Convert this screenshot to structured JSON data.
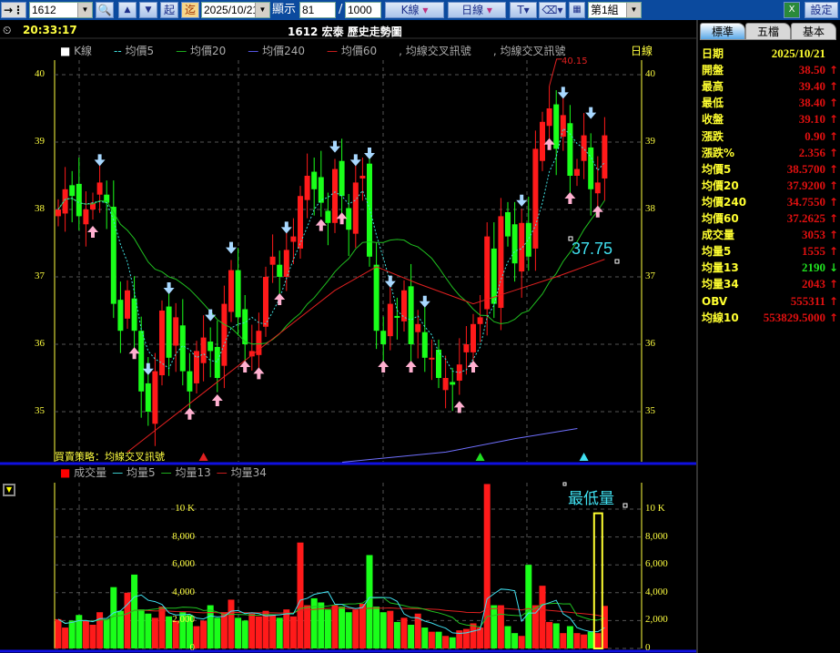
{
  "toolbar": {
    "stock_code": "1612",
    "start_label": "起",
    "end_label": "迄",
    "date": "2025/10/21",
    "display_label": "顯示",
    "display_count": "81",
    "slash": "/",
    "display_total": "1000",
    "kline_label": "K線",
    "period_label": "日線",
    "group": "第1組",
    "settings_label": "設定",
    "caret": "▾",
    "dd": "▼"
  },
  "header": {
    "time": "20:33:17",
    "title": "1612 宏泰  歷史走勢圖",
    "period": "日線"
  },
  "price_legend": [
    {
      "label": "K線",
      "color": "#ffffff",
      "mark": "■"
    },
    {
      "label": "均價5",
      "color": "#40e0e0",
      "mark": "--"
    },
    {
      "label": "均價20",
      "color": "#20c020",
      "mark": "—"
    },
    {
      "label": "均價240",
      "color": "#6060ff",
      "mark": "—"
    },
    {
      "label": "均價60",
      "color": "#e02020",
      "mark": "—"
    },
    {
      "label": "均線交叉訊號",
      "color": "#aaaaaa",
      "mark": ","
    },
    {
      "label": "均線交叉訊號",
      "color": "#aaaaaa",
      "mark": ","
    }
  ],
  "strategy": "買賣策略：均線交叉訊號",
  "annotations": {
    "high": "40.15",
    "price_cursor": "37.75",
    "vol_cursor": "最低量"
  },
  "volume_legend": [
    {
      "label": "成交量",
      "color": "#ff0000",
      "mark": "■"
    },
    {
      "label": "均量5",
      "color": "#40e0e0",
      "mark": "—"
    },
    {
      "label": "均量13",
      "color": "#20c020",
      "mark": "—"
    },
    {
      "label": "均量34",
      "color": "#e02020",
      "mark": "—"
    }
  ],
  "price_ticks": [
    "35",
    "36",
    "37",
    "38",
    "39",
    "40"
  ],
  "volume_ticks": [
    "0",
    "2,000",
    "4,000",
    "6,000",
    "8,000",
    "10 K"
  ],
  "panel": {
    "tabs": [
      "標準",
      "五檔",
      "基本"
    ],
    "rows": [
      {
        "k": "日期",
        "v": "2025/10/21",
        "a": "",
        "c": "#ffff30"
      },
      {
        "k": "開盤",
        "v": "38.50",
        "a": "↑",
        "c": "#e01010"
      },
      {
        "k": "最高",
        "v": "39.40",
        "a": "↑",
        "c": "#e01010"
      },
      {
        "k": "最低",
        "v": "38.40",
        "a": "↑",
        "c": "#e01010"
      },
      {
        "k": "收盤",
        "v": "39.10",
        "a": "↑",
        "c": "#e01010"
      },
      {
        "k": "漲跌",
        "v": "0.90",
        "a": "↑",
        "c": "#e01010"
      },
      {
        "k": "漲跌%",
        "v": "2.356",
        "a": "↑",
        "c": "#e01010"
      },
      {
        "k": "均價5",
        "v": "38.5700",
        "a": "↑",
        "c": "#e01010"
      },
      {
        "k": "均價20",
        "v": "37.9200",
        "a": "↑",
        "c": "#e01010"
      },
      {
        "k": "均價240",
        "v": "34.7550",
        "a": "↑",
        "c": "#e01010"
      },
      {
        "k": "均價60",
        "v": "37.2625",
        "a": "↑",
        "c": "#e01010"
      },
      {
        "k": "成交量",
        "v": "3053",
        "a": "↑",
        "c": "#e01010"
      },
      {
        "k": "均量5",
        "v": "1555",
        "a": "↑",
        "c": "#e01010"
      },
      {
        "k": "均量13",
        "v": "2190",
        "a": "↓",
        "c": "#20e020"
      },
      {
        "k": "均量34",
        "v": "2043",
        "a": "↑",
        "c": "#e01010"
      },
      {
        "k": "OBV",
        "v": "555311",
        "a": "↑",
        "c": "#e01010"
      },
      {
        "k": "均線10",
        "v": "553829.5000",
        "a": "↑",
        "c": "#e01010"
      }
    ]
  },
  "chart_data": {
    "type": "candlestick",
    "close": [
      38.0,
      38.3,
      38.2,
      37.9,
      38.0,
      38.1,
      38.4,
      38.1,
      36.6,
      36.2,
      36.8,
      36.2,
      35.3,
      35.0,
      35.6,
      36.5,
      35.8,
      36.4,
      35.6,
      35.3,
      35.9,
      36.1,
      35.9,
      35.5,
      36.6,
      37.1,
      36.4,
      36.0,
      35.9,
      36.2,
      37.0,
      37.3,
      37.0,
      37.4,
      37.6,
      38.2,
      38.5,
      38.3,
      38.1,
      37.8,
      38.6,
      38.2,
      37.7,
      38.4,
      38.5,
      37.3,
      36.2,
      36.0,
      36.6,
      36.4,
      36.8,
      36.0,
      36.3,
      35.8,
      35.8,
      35.5,
      35.5,
      35.4,
      35.7,
      36.0,
      36.3,
      36.4,
      37.6,
      36.6,
      37.9,
      37.6,
      37.2,
      37.8,
      37.3,
      38.9,
      39.3,
      39.5,
      38.9,
      39.4,
      38.5,
      38.6,
      39.1,
      38.3,
      38.4,
      39.1
    ],
    "volume": [
      2.1,
      1.5,
      2.0,
      2.4,
      2.0,
      1.7,
      2.6,
      2.1,
      4.4,
      2.7,
      4.0,
      5.3,
      2.8,
      2.5,
      2.2,
      3.0,
      2.3,
      2.0,
      2.6,
      2.4,
      1.6,
      2.0,
      3.1,
      2.2,
      2.6,
      3.5,
      2.2,
      2.0,
      2.5,
      2.3,
      2.7,
      2.4,
      2.2,
      2.8,
      2.3,
      7.6,
      3.1,
      3.6,
      3.3,
      2.8,
      3.1,
      3.0,
      2.6,
      2.8,
      3.2,
      6.7,
      3.0,
      2.6,
      2.7,
      1.9,
      2.2,
      1.7,
      2.5,
      1.5,
      1.2,
      1.2,
      0.9,
      0.8,
      1.3,
      1.4,
      1.8,
      1.5,
      11.8,
      3.1,
      3.1,
      1.6,
      1.1,
      0.9,
      6.0,
      3.1,
      4.5,
      1.9,
      1.8,
      1.1,
      1.6,
      1.1,
      1.0,
      1.2,
      1.1,
      3.053
    ],
    "volume_unit": "thousand",
    "ma60": [
      [
        10,
        34.4
      ],
      [
        20,
        35.2
      ],
      [
        30,
        36.0
      ],
      [
        40,
        36.8
      ],
      [
        46,
        37.15
      ],
      [
        52,
        36.9
      ],
      [
        60,
        36.6
      ],
      [
        66,
        36.8
      ],
      [
        72,
        37.0
      ],
      [
        79,
        37.26
      ]
    ],
    "ma240": [
      [
        45,
        34.25
      ],
      [
        60,
        34.4
      ],
      [
        70,
        34.6
      ],
      [
        79,
        34.75
      ]
    ],
    "buy_signals": [
      5,
      11,
      19,
      23,
      27,
      29,
      32,
      38,
      41,
      47,
      51,
      58,
      60,
      71,
      74,
      78
    ],
    "sell_signals": [
      6,
      13,
      16,
      22,
      25,
      33,
      40,
      43,
      45,
      48,
      53,
      67,
      73,
      77
    ],
    "markers": [
      {
        "index": 21,
        "color": "#e02020"
      },
      {
        "index": 61,
        "color": "#20e020"
      },
      {
        "index": 76,
        "color": "#40e0f0"
      }
    ],
    "ylim": [
      34.4,
      40.3
    ],
    "vol_ylim": [
      0,
      11.8
    ],
    "highlight_index": 78
  }
}
